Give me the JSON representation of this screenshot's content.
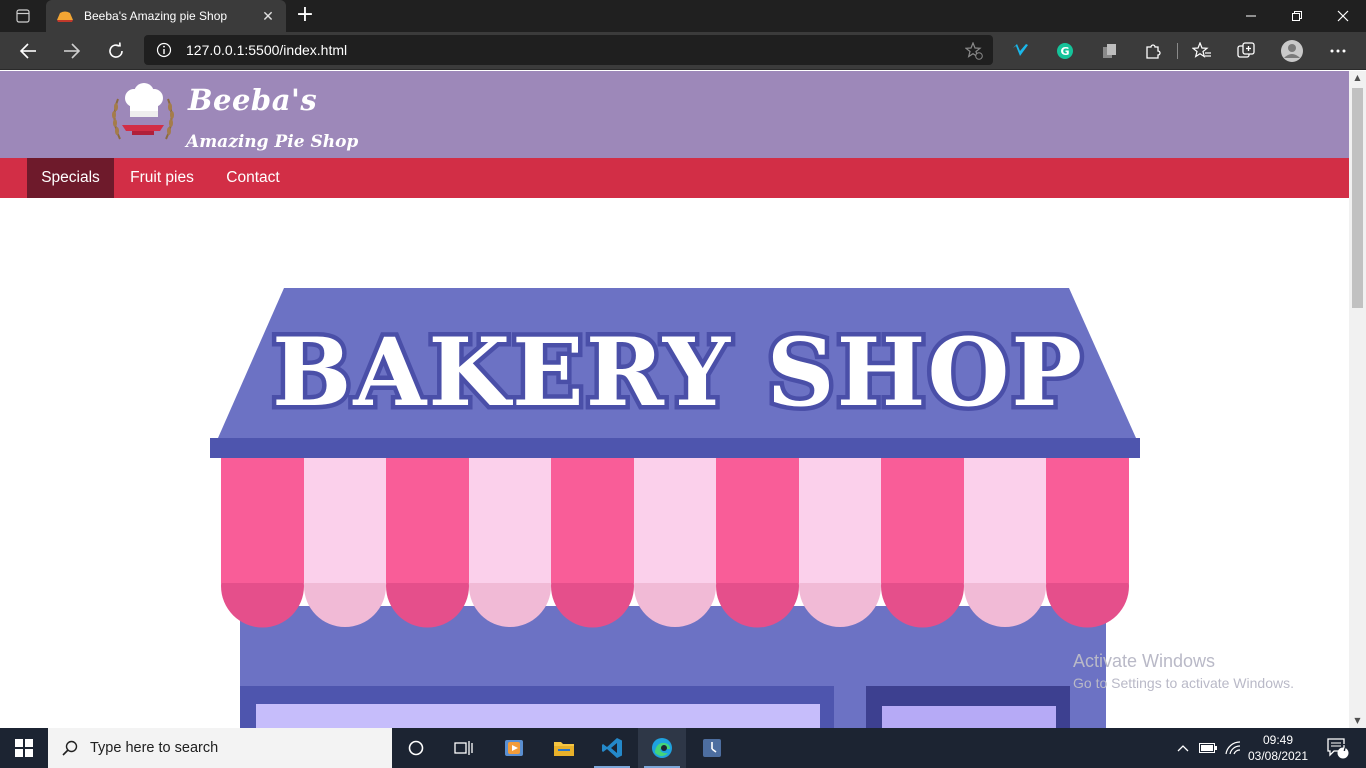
{
  "browser": {
    "tab": {
      "title": "Beeba's Amazing pie Shop"
    },
    "new_tab_symbol": "+",
    "address": {
      "url": "127.0.0.1:5500/index.html"
    },
    "extensions": [
      "vimeo-icon",
      "grammarly-icon",
      "extension-icon",
      "puzzle-icon",
      "favorites-icon",
      "collections-icon",
      "profile-icon",
      "more-icon"
    ]
  },
  "site": {
    "brand_line1": "Beeba's",
    "brand_line2": "Amazing Pie Shop",
    "nav": [
      {
        "label": "Specials",
        "active": true
      },
      {
        "label": "Fruit pies",
        "active": false
      },
      {
        "label": "Contact",
        "active": false
      }
    ],
    "hero": {
      "sign_text": "BAKERY SHOP"
    }
  },
  "watermark": {
    "line1": "Activate Windows",
    "line2": "Go to Settings to activate Windows."
  },
  "taskbar": {
    "search_placeholder": "Type here to search",
    "time": "09:49",
    "date": "03/08/2021",
    "notification_count": "7"
  },
  "colors": {
    "header_bg": "#9d88b9",
    "nav_bg": "#d22e46",
    "nav_active_bg": "#6e1a2b",
    "shop_roof": "#6c72c4",
    "awning_pink": "#f95d98",
    "awning_light": "#fbd0eb"
  }
}
